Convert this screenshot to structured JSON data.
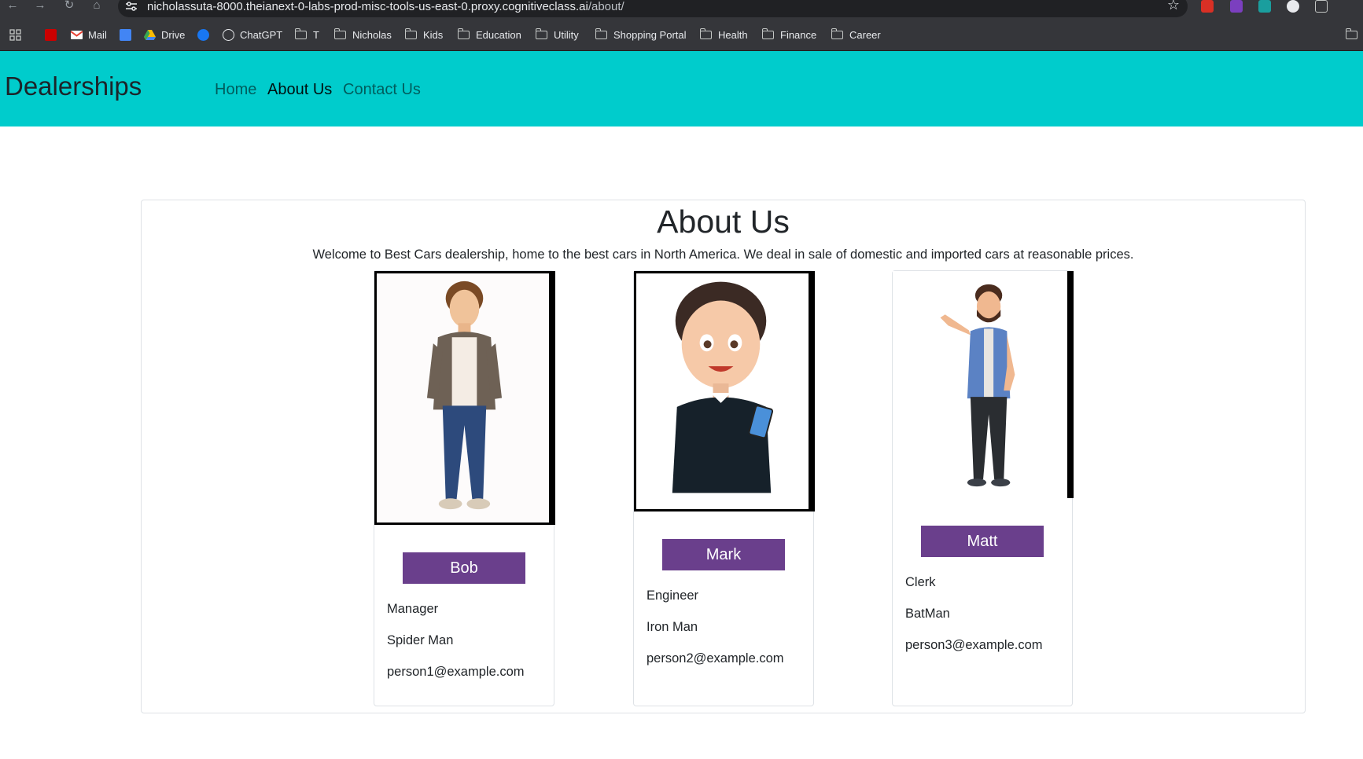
{
  "browser": {
    "url_host": "nicholassuta-8000.theianext-0-labs-prod-misc-tools-us-east-0.proxy.cognitiveclass.ai",
    "url_path": "/about/",
    "bookmarks": [
      {
        "label": "",
        "icon": "cnn-icon"
      },
      {
        "label": "Mail",
        "icon": "gmail-icon"
      },
      {
        "label": "",
        "icon": "calendar-icon"
      },
      {
        "label": "Drive",
        "icon": "drive-icon"
      },
      {
        "label": "",
        "icon": "facebook-icon"
      },
      {
        "label": "ChatGPT",
        "icon": "chatgpt-icon"
      },
      {
        "label": "T",
        "icon": "folder-icon"
      },
      {
        "label": "Nicholas",
        "icon": "folder-icon"
      },
      {
        "label": "Kids",
        "icon": "folder-icon"
      },
      {
        "label": "Education",
        "icon": "folder-icon"
      },
      {
        "label": "Utility",
        "icon": "folder-icon"
      },
      {
        "label": "Shopping Portal",
        "icon": "folder-icon"
      },
      {
        "label": "Health",
        "icon": "folder-icon"
      },
      {
        "label": "Finance",
        "icon": "folder-icon"
      },
      {
        "label": "Career",
        "icon": "folder-icon"
      }
    ]
  },
  "navbar": {
    "brand": "Dealerships",
    "links": [
      "Home",
      "About Us",
      "Contact Us"
    ],
    "active": "About Us",
    "color": "#00cccc"
  },
  "about": {
    "title": "About Us",
    "subtitle": "Welcome to Best Cars dealership, home to the best cars in North America. We deal in sale of domestic and imported cars at reasonable prices."
  },
  "people": [
    {
      "name": "Bob",
      "title": "Manager",
      "description": "Spider Man",
      "email": "person1@example.com"
    },
    {
      "name": "Mark",
      "title": "Engineer",
      "description": "Iron Man",
      "email": "person2@example.com"
    },
    {
      "name": "Matt",
      "title": "Clerk",
      "description": "BatMan",
      "email": "person3@example.com"
    }
  ],
  "colors": {
    "button": "#6a3f8c"
  }
}
